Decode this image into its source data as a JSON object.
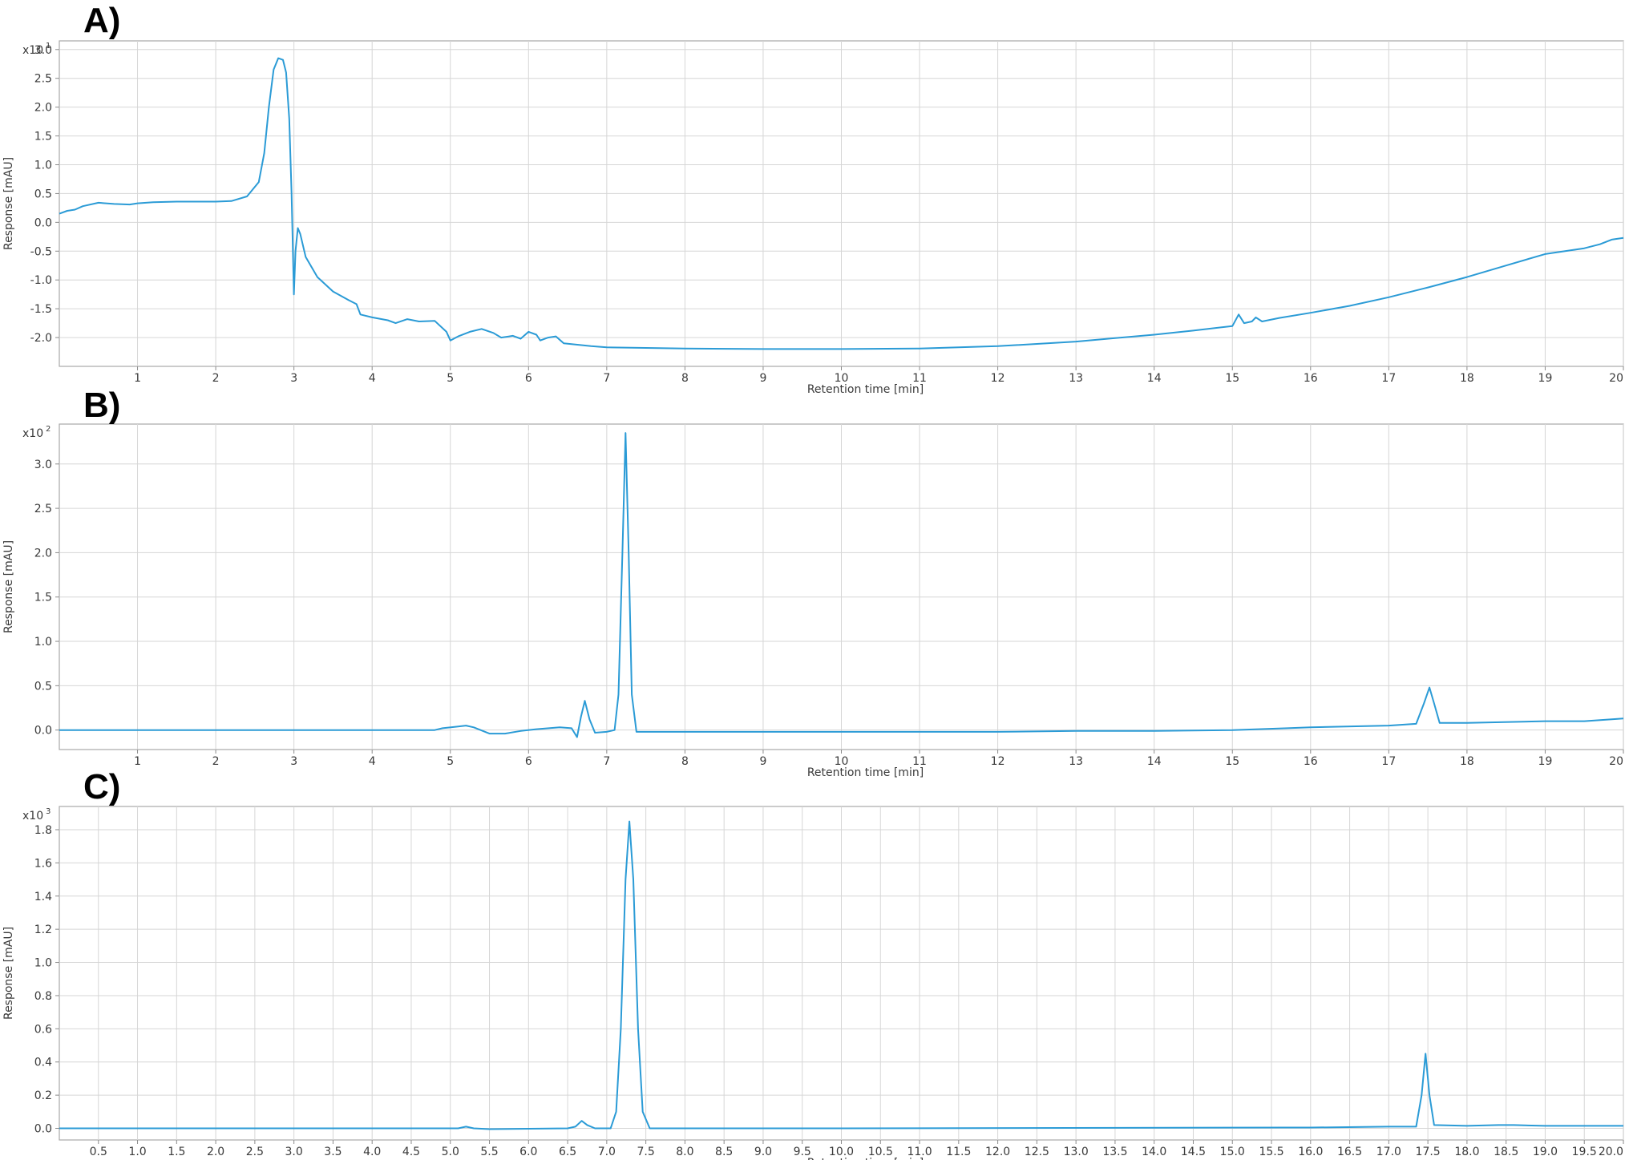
{
  "chart_data": [
    {
      "type": "line",
      "panel_label": "A)",
      "multiplier": "x10",
      "multiplier_exp": "1",
      "xlabel": "Retention time [min]",
      "ylabel": "Response [mAU]",
      "xlim": [
        0,
        20
      ],
      "ylim": [
        -2.5,
        3.15
      ],
      "x_ticks": [
        1,
        2,
        3,
        4,
        5,
        6,
        7,
        8,
        9,
        10,
        11,
        12,
        13,
        14,
        15,
        16,
        17,
        18,
        19,
        20
      ],
      "x_tick_labels": [
        "1",
        "2",
        "3",
        "4",
        "5",
        "6",
        "7",
        "8",
        "9",
        "10",
        "11",
        "12",
        "13",
        "14",
        "15",
        "16",
        "17",
        "18",
        "19",
        "20"
      ],
      "y_ticks": [
        -2.0,
        -1.5,
        -1.0,
        -0.5,
        0.0,
        0.5,
        1.0,
        1.5,
        2.0,
        2.5,
        3.0
      ],
      "y_tick_labels": [
        "-2.0",
        "-1.5",
        "-1.0",
        "-0.5",
        "0.0",
        "0.5",
        "1.0",
        "1.5",
        "2.0",
        "2.5",
        "3.0"
      ],
      "grid": true,
      "color": "#2b9bd6",
      "series": [
        {
          "points": [
            [
              0,
              0.15
            ],
            [
              0.1,
              0.2
            ],
            [
              0.2,
              0.22
            ],
            [
              0.3,
              0.28
            ],
            [
              0.5,
              0.34
            ],
            [
              0.7,
              0.32
            ],
            [
              0.9,
              0.31
            ],
            [
              1.0,
              0.33
            ],
            [
              1.2,
              0.35
            ],
            [
              1.5,
              0.36
            ],
            [
              2.0,
              0.36
            ],
            [
              2.2,
              0.37
            ],
            [
              2.4,
              0.45
            ],
            [
              2.55,
              0.7
            ],
            [
              2.62,
              1.2
            ],
            [
              2.68,
              2.0
            ],
            [
              2.74,
              2.65
            ],
            [
              2.8,
              2.85
            ],
            [
              2.86,
              2.82
            ],
            [
              2.9,
              2.6
            ],
            [
              2.94,
              1.8
            ],
            [
              2.97,
              0.5
            ],
            [
              3.0,
              -1.25
            ],
            [
              3.02,
              -0.5
            ],
            [
              3.05,
              -0.1
            ],
            [
              3.08,
              -0.2
            ],
            [
              3.15,
              -0.6
            ],
            [
              3.3,
              -0.95
            ],
            [
              3.5,
              -1.2
            ],
            [
              3.7,
              -1.35
            ],
            [
              3.8,
              -1.42
            ],
            [
              3.85,
              -1.6
            ],
            [
              4.0,
              -1.65
            ],
            [
              4.2,
              -1.7
            ],
            [
              4.3,
              -1.75
            ],
            [
              4.45,
              -1.68
            ],
            [
              4.6,
              -1.72
            ],
            [
              4.8,
              -1.71
            ],
            [
              4.95,
              -1.9
            ],
            [
              5.0,
              -2.05
            ],
            [
              5.1,
              -1.98
            ],
            [
              5.25,
              -1.9
            ],
            [
              5.4,
              -1.85
            ],
            [
              5.55,
              -1.92
            ],
            [
              5.65,
              -2.0
            ],
            [
              5.8,
              -1.97
            ],
            [
              5.9,
              -2.02
            ],
            [
              6.0,
              -1.9
            ],
            [
              6.1,
              -1.95
            ],
            [
              6.15,
              -2.05
            ],
            [
              6.25,
              -2.0
            ],
            [
              6.35,
              -1.98
            ],
            [
              6.45,
              -2.1
            ],
            [
              6.6,
              -2.12
            ],
            [
              6.8,
              -2.15
            ],
            [
              7.0,
              -2.17
            ],
            [
              7.5,
              -2.18
            ],
            [
              8.0,
              -2.19
            ],
            [
              9.0,
              -2.2
            ],
            [
              10.0,
              -2.2
            ],
            [
              11.0,
              -2.19
            ],
            [
              12.0,
              -2.15
            ],
            [
              13.0,
              -2.07
            ],
            [
              14.0,
              -1.95
            ],
            [
              14.5,
              -1.88
            ],
            [
              15.0,
              -1.8
            ],
            [
              15.08,
              -1.6
            ],
            [
              15.15,
              -1.75
            ],
            [
              15.25,
              -1.72
            ],
            [
              15.3,
              -1.65
            ],
            [
              15.38,
              -1.72
            ],
            [
              15.6,
              -1.66
            ],
            [
              16.0,
              -1.57
            ],
            [
              16.5,
              -1.45
            ],
            [
              17.0,
              -1.3
            ],
            [
              17.5,
              -1.13
            ],
            [
              18.0,
              -0.95
            ],
            [
              18.5,
              -0.75
            ],
            [
              19.0,
              -0.55
            ],
            [
              19.5,
              -0.45
            ],
            [
              19.7,
              -0.38
            ],
            [
              19.85,
              -0.3
            ],
            [
              20.0,
              -0.27
            ]
          ]
        }
      ]
    },
    {
      "type": "line",
      "panel_label": "B)",
      "multiplier": "x10",
      "multiplier_exp": "2",
      "xlabel": "Retention time [min]",
      "ylabel": "Response [mAU]",
      "xlim": [
        0,
        20
      ],
      "ylim": [
        -0.22,
        3.45
      ],
      "x_ticks": [
        1,
        2,
        3,
        4,
        5,
        6,
        7,
        8,
        9,
        10,
        11,
        12,
        13,
        14,
        15,
        16,
        17,
        18,
        19,
        20
      ],
      "x_tick_labels": [
        "1",
        "2",
        "3",
        "4",
        "5",
        "6",
        "7",
        "8",
        "9",
        "10",
        "11",
        "12",
        "13",
        "14",
        "15",
        "16",
        "17",
        "18",
        "19",
        "20"
      ],
      "y_ticks": [
        0.0,
        0.5,
        1.0,
        1.5,
        2.0,
        2.5,
        3.0
      ],
      "y_tick_labels": [
        "0.0",
        "0.5",
        "1.0",
        "1.5",
        "2.0",
        "2.5",
        "3.0"
      ],
      "grid": true,
      "color": "#2b9bd6",
      "series": [
        {
          "points": [
            [
              0,
              0.0
            ],
            [
              4.8,
              0.0
            ],
            [
              4.9,
              0.02
            ],
            [
              5.1,
              0.04
            ],
            [
              5.2,
              0.05
            ],
            [
              5.3,
              0.03
            ],
            [
              5.5,
              -0.04
            ],
            [
              5.7,
              -0.04
            ],
            [
              5.9,
              -0.01
            ],
            [
              6.1,
              0.01
            ],
            [
              6.4,
              0.03
            ],
            [
              6.55,
              0.02
            ],
            [
              6.62,
              -0.08
            ],
            [
              6.67,
              0.15
            ],
            [
              6.72,
              0.33
            ],
            [
              6.78,
              0.12
            ],
            [
              6.85,
              -0.03
            ],
            [
              7.0,
              -0.02
            ],
            [
              7.1,
              0.0
            ],
            [
              7.15,
              0.4
            ],
            [
              7.2,
              2.0
            ],
            [
              7.24,
              3.35
            ],
            [
              7.28,
              2.0
            ],
            [
              7.32,
              0.4
            ],
            [
              7.38,
              -0.02
            ],
            [
              7.6,
              -0.02
            ],
            [
              8.0,
              -0.02
            ],
            [
              10.0,
              -0.02
            ],
            [
              12.0,
              -0.02
            ],
            [
              13.0,
              -0.01
            ],
            [
              14.0,
              -0.01
            ],
            [
              15.0,
              0.0
            ],
            [
              15.7,
              0.02
            ],
            [
              16.0,
              0.03
            ],
            [
              17.0,
              0.05
            ],
            [
              17.35,
              0.07
            ],
            [
              17.45,
              0.3
            ],
            [
              17.52,
              0.48
            ],
            [
              17.58,
              0.3
            ],
            [
              17.65,
              0.08
            ],
            [
              18.0,
              0.08
            ],
            [
              19.0,
              0.1
            ],
            [
              19.5,
              0.1
            ],
            [
              20.0,
              0.13
            ]
          ]
        }
      ]
    },
    {
      "type": "line",
      "panel_label": "C)",
      "multiplier": "x10",
      "multiplier_exp": "3",
      "xlabel": "Retention time [min]",
      "ylabel": "Response [mAU]",
      "xlim": [
        0,
        20
      ],
      "ylim": [
        -0.07,
        1.94
      ],
      "x_ticks": [
        0.5,
        1.0,
        1.5,
        2.0,
        2.5,
        3.0,
        3.5,
        4.0,
        4.5,
        5.0,
        5.5,
        6.0,
        6.5,
        7.0,
        7.5,
        8.0,
        8.5,
        9.0,
        9.5,
        10.0,
        10.5,
        11.0,
        11.5,
        12.0,
        12.5,
        13.0,
        13.5,
        14.0,
        14.5,
        15.0,
        15.5,
        16.0,
        16.5,
        17.0,
        17.5,
        18.0,
        18.5,
        19.0,
        19.5,
        20.0
      ],
      "x_tick_labels": [
        "0.5",
        "1.0",
        "1.5",
        "2.0",
        "2.5",
        "3.0",
        "3.5",
        "4.0",
        "4.5",
        "5.0",
        "5.5",
        "6.0",
        "6.5",
        "7.0",
        "7.5",
        "8.0",
        "8.5",
        "9.0",
        "9.5",
        "10.0",
        "10.5",
        "11.0",
        "11.5",
        "12.0",
        "12.5",
        "13.0",
        "13.5",
        "14.0",
        "14.5",
        "15.0",
        "15.5",
        "16.0",
        "16.5",
        "17.0",
        "17.5",
        "18.0",
        "18.5",
        "19.0",
        "19.5",
        "20.0"
      ],
      "y_ticks": [
        0.0,
        0.2,
        0.4,
        0.6,
        0.8,
        1.0,
        1.2,
        1.4,
        1.6,
        1.8
      ],
      "y_tick_labels": [
        "0.0",
        "0.2",
        "0.4",
        "0.6",
        "0.8",
        "1.0",
        "1.2",
        "1.4",
        "1.6",
        "1.8"
      ],
      "grid": true,
      "color": "#2b9bd6",
      "series": [
        {
          "points": [
            [
              0,
              0.0
            ],
            [
              5.1,
              0.0
            ],
            [
              5.2,
              0.01
            ],
            [
              5.3,
              0.0
            ],
            [
              5.5,
              -0.005
            ],
            [
              6.5,
              0.0
            ],
            [
              6.6,
              0.01
            ],
            [
              6.68,
              0.045
            ],
            [
              6.75,
              0.02
            ],
            [
              6.85,
              0.0
            ],
            [
              7.05,
              0.0
            ],
            [
              7.12,
              0.1
            ],
            [
              7.18,
              0.6
            ],
            [
              7.24,
              1.5
            ],
            [
              7.29,
              1.85
            ],
            [
              7.34,
              1.5
            ],
            [
              7.4,
              0.6
            ],
            [
              7.46,
              0.1
            ],
            [
              7.55,
              0.0
            ],
            [
              10.0,
              0.0
            ],
            [
              15.7,
              0.005
            ],
            [
              16.0,
              0.005
            ],
            [
              17.0,
              0.01
            ],
            [
              17.35,
              0.01
            ],
            [
              17.42,
              0.2
            ],
            [
              17.47,
              0.45
            ],
            [
              17.52,
              0.2
            ],
            [
              17.58,
              0.02
            ],
            [
              18.0,
              0.015
            ],
            [
              18.4,
              0.02
            ],
            [
              18.6,
              0.02
            ],
            [
              19.0,
              0.015
            ],
            [
              20.0,
              0.015
            ]
          ]
        }
      ]
    }
  ]
}
